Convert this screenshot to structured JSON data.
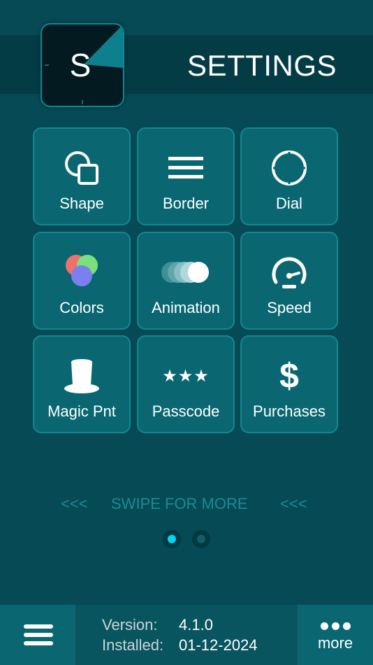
{
  "header": {
    "app_icon_letter": "S",
    "title": "SETTINGS"
  },
  "tiles": [
    {
      "label": "Shape",
      "icon": "shape-icon"
    },
    {
      "label": "Border",
      "icon": "border-icon"
    },
    {
      "label": "Dial",
      "icon": "dial-icon"
    },
    {
      "label": "Colors",
      "icon": "colors-icon"
    },
    {
      "label": "Animation",
      "icon": "animation-icon"
    },
    {
      "label": "Speed",
      "icon": "speedometer-icon"
    },
    {
      "label": "Magic Pnt",
      "icon": "top-hat-icon"
    },
    {
      "label": "Passcode",
      "icon": "stars-icon"
    },
    {
      "label": "Purchases",
      "icon": "dollar-icon"
    }
  ],
  "passcode_stars": "★★★",
  "purchases_symbol": "$",
  "swipe": {
    "left_arrows": "<<<",
    "text": "SWIPE FOR MORE",
    "right_arrows": "<<<"
  },
  "pager": {
    "count": 2,
    "active": 1
  },
  "footer": {
    "version_label": "Version:",
    "version_value": "4.1.0",
    "installed_label": "Installed:",
    "installed_value": "01-12-2024",
    "more_label": "more"
  },
  "colors": {
    "background": "#054a54",
    "tile": "#0a6771",
    "accent_cyan": "#00d4f0",
    "swipe_text": "#1a8b96"
  }
}
